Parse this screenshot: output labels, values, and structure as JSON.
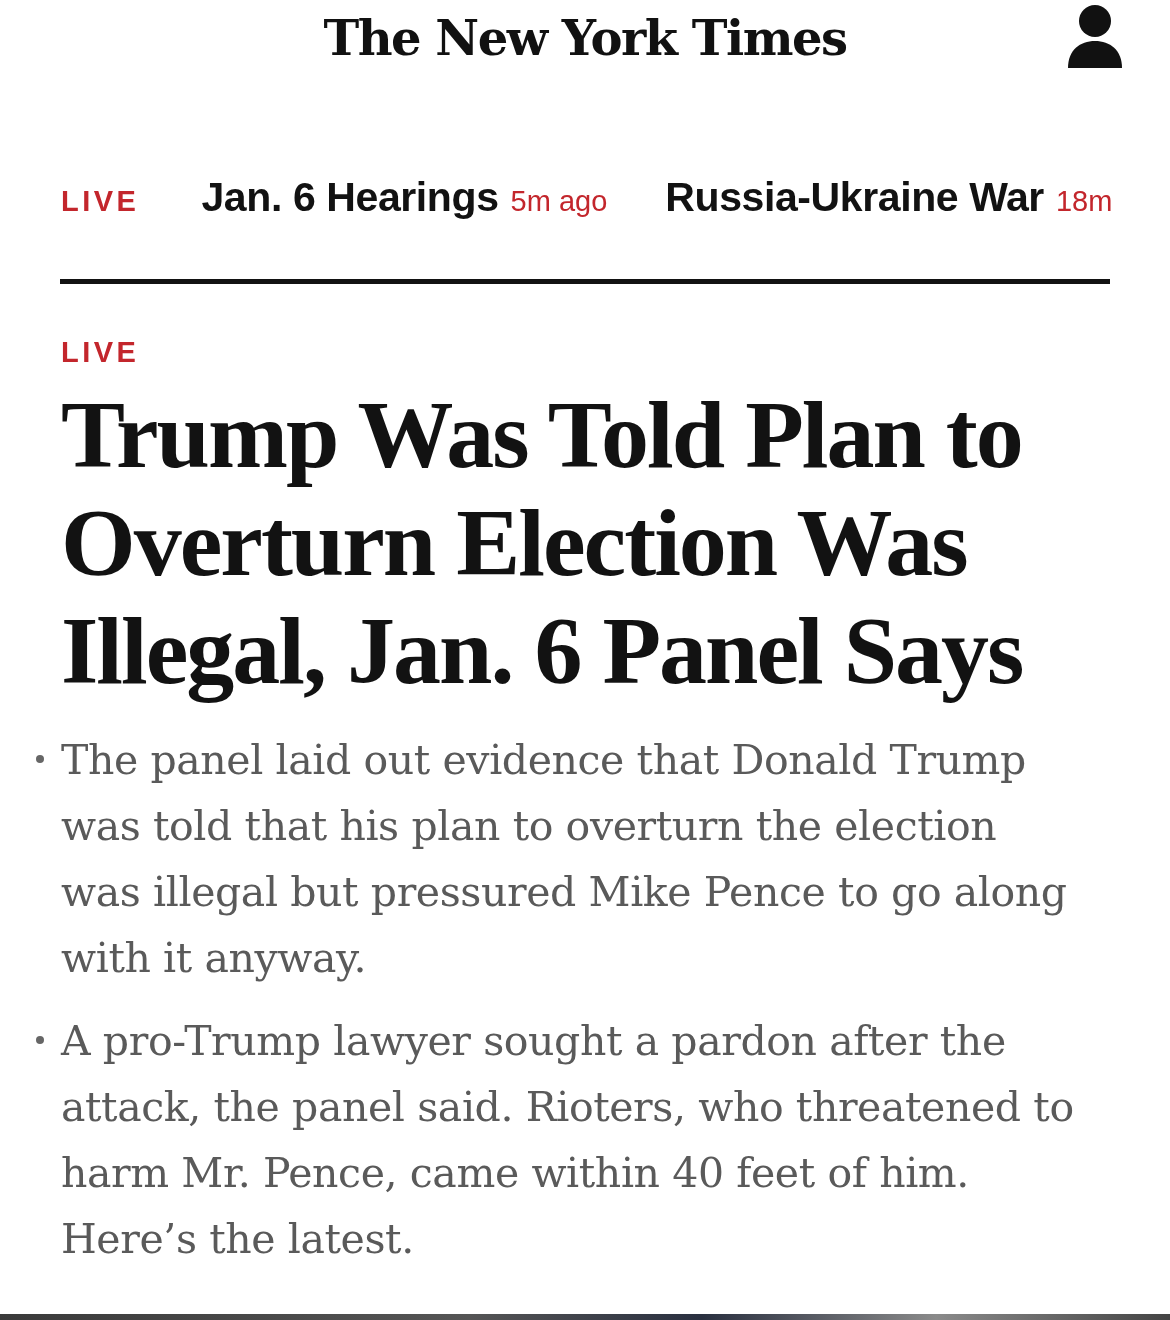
{
  "masthead": {
    "logo": "The New York Times"
  },
  "nav": {
    "live_label": "LIVE",
    "items": [
      {
        "title": "Jan. 6 Hearings",
        "time": "5m ago"
      },
      {
        "title": "Russia-Ukraine War",
        "time": "18m"
      }
    ]
  },
  "article": {
    "label": "LIVE",
    "headline": "Trump Was Told Plan to Overturn Election Was Illegal, Jan. 6 Panel Says",
    "bullets": [
      "The panel laid out evidence that Donald Trump was told that his plan to overturn the election was illegal but pressured Mike Pence to go along with it anyway.",
      "A pro-Trump lawyer sought a pardon after the attack, the panel said. Rioters, who threatened to harm Mr. Pence, came within 40 feet of him. Here’s the latest."
    ]
  }
}
